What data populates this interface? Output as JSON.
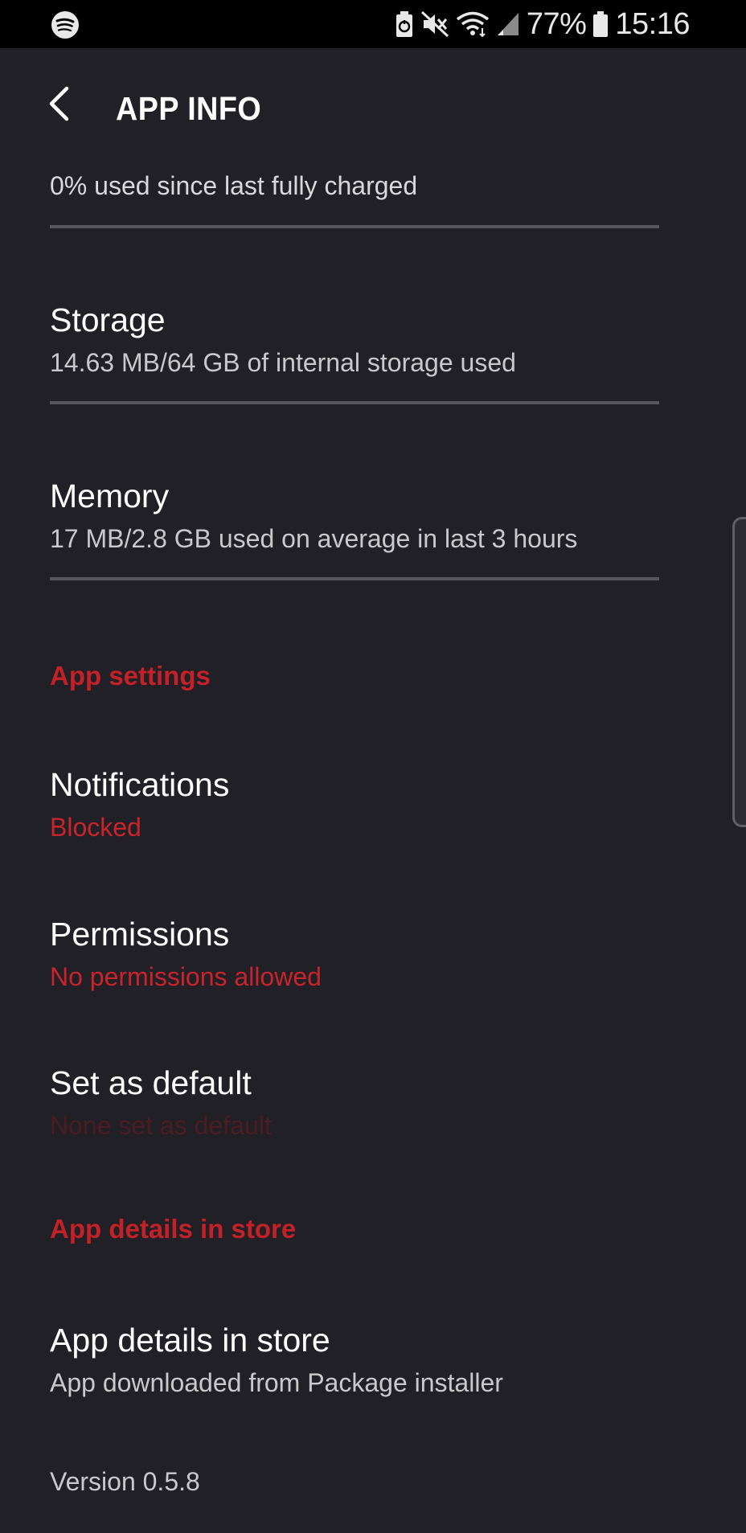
{
  "status_bar": {
    "battery_percent": "77%",
    "time": "15:16",
    "icons": [
      "spotify-icon",
      "battery-saver-icon",
      "mute-icon",
      "wifi-icon",
      "signal-icon",
      "battery-icon"
    ]
  },
  "header": {
    "title": "APP INFO",
    "back_icon": "back-arrow-icon"
  },
  "battery": {
    "summary": "0% used since last fully charged"
  },
  "storage": {
    "title": "Storage",
    "subtitle": "14.63 MB/64 GB of internal storage used"
  },
  "memory": {
    "title": "Memory",
    "subtitle": "17 MB/2.8 GB used on average in last 3 hours"
  },
  "app_settings": {
    "header": "App settings",
    "notifications": {
      "title": "Notifications",
      "subtitle": "Blocked"
    },
    "permissions": {
      "title": "Permissions",
      "subtitle": "No permissions allowed"
    },
    "set_default": {
      "title": "Set as default",
      "subtitle": "None set as default"
    }
  },
  "store": {
    "header": "App details in store",
    "title": "App details in store",
    "subtitle": "App downloaded from Package installer"
  },
  "footer": {
    "version": "Version 0.5.8"
  },
  "colors": {
    "background": "#212026",
    "status_bar": "#000000",
    "accent_red": "#c22127",
    "divider": "#56565b"
  }
}
